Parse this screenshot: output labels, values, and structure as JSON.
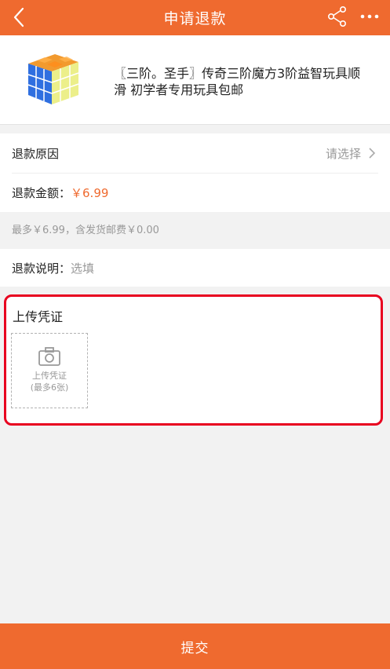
{
  "header": {
    "title": "申请退款"
  },
  "product": {
    "title": "〖三阶。圣手〗传奇三阶魔方3阶益智玩具顺滑 初学者专用玩具包邮"
  },
  "refund_reason": {
    "label": "退款原因",
    "placeholder": "请选择"
  },
  "refund_amount": {
    "label": "退款金额：",
    "value": "￥6.99"
  },
  "refund_note": "最多￥6.99，含发货邮费￥0.00",
  "refund_desc": {
    "label": "退款说明：",
    "placeholder": "选填"
  },
  "proof": {
    "title": "上传凭证",
    "upload_line1": "上传凭证",
    "upload_line2": "(最多6张)"
  },
  "submit_label": "提交",
  "colors": {
    "accent": "#ef6a2f",
    "highlight_border": "#e8001f"
  }
}
